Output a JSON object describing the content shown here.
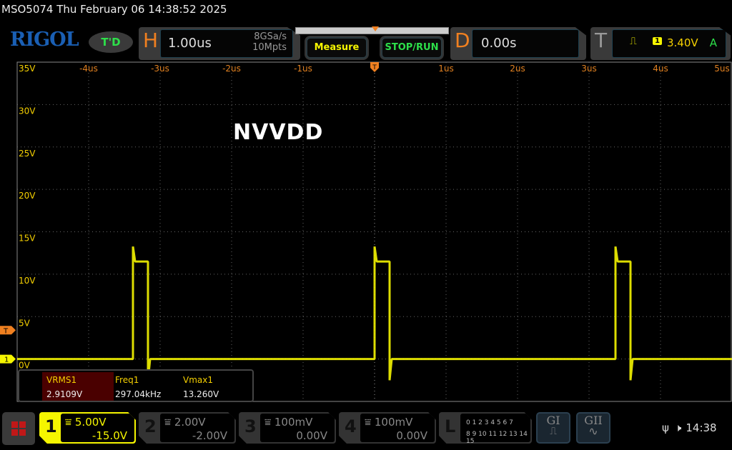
{
  "title": "MSO5074  Thu February 06 14:38:52 2025",
  "logo": "RIGOL",
  "trigger_status": "T'D",
  "horizontal": {
    "letter": "H",
    "scale": "1.00us",
    "sample_rate": "8GSa/s",
    "memory": "10Mpts"
  },
  "buttons": {
    "measure": "Measure",
    "stop_run": "STOP/RUN"
  },
  "delay": {
    "letter": "D",
    "value": "0.00s"
  },
  "trigger": {
    "letter": "T",
    "source": "1",
    "level": "3.40V",
    "mode": "A"
  },
  "annotation": "NVVDD",
  "measurements": [
    {
      "name": "VRMS1",
      "value": "2.9109V"
    },
    {
      "name": "Freq1",
      "value": "297.04kHz"
    },
    {
      "name": "Vmax1",
      "value": "13.260V"
    }
  ],
  "channels": [
    {
      "num": "1",
      "scale": "5.00V",
      "offset": "-15.0V"
    },
    {
      "num": "2",
      "scale": "2.00V",
      "offset": "-2.00V"
    },
    {
      "num": "3",
      "scale": "100mV",
      "offset": "0.00V"
    },
    {
      "num": "4",
      "scale": "100mV",
      "offset": "0.00V"
    }
  ],
  "logic": {
    "letter": "L",
    "row1": "0 1 2 3  4 5 6 7",
    "row2": "8 9 10 11 12 13 14 15"
  },
  "generators": [
    "GI",
    "GII"
  ],
  "clock": "14:38",
  "markers": {
    "trigger": "T",
    "ch1": "1"
  },
  "chart_data": {
    "type": "line",
    "x_ticks": [
      "-4us",
      "-3us",
      "-2us",
      "-1us",
      "",
      "1us",
      "2us",
      "3us",
      "4us",
      "5us"
    ],
    "x_tick_values": [
      -4,
      -3,
      -2,
      -1,
      0,
      1,
      2,
      3,
      4,
      5
    ],
    "y_ticks": [
      "35V",
      "30V",
      "25V",
      "20V",
      "15V",
      "10V",
      "5V",
      "0V"
    ],
    "y_tick_values": [
      35,
      30,
      25,
      20,
      15,
      10,
      5,
      0
    ],
    "xlim": [
      -5,
      5
    ],
    "ylim": [
      -5,
      35
    ],
    "series": [
      {
        "name": "CH1",
        "color": "#f5f500",
        "low": 0,
        "high": 11.5,
        "spike": 13.26,
        "undershoot": -2.5,
        "pulses": [
          [
            -3.38,
            -3.17
          ],
          [
            0,
            0.21
          ],
          [
            3.37,
            3.58
          ]
        ]
      }
    ]
  }
}
